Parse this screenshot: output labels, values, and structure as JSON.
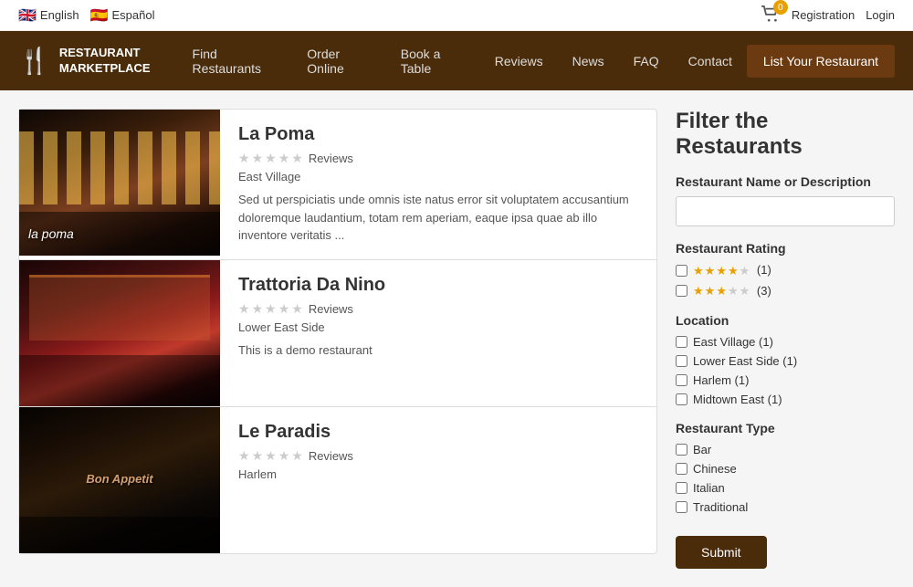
{
  "topBar": {
    "languages": [
      {
        "name": "English",
        "flag": "🇬🇧"
      },
      {
        "name": "Español",
        "flag": "🇪🇸"
      }
    ],
    "cartCount": "0",
    "links": [
      "Registration",
      "Login"
    ]
  },
  "nav": {
    "brand": {
      "icon": "🍴",
      "line1": "RESTAURANT",
      "line2": "MARKETPLACE"
    },
    "links": [
      "Find Restaurants",
      "Order Online",
      "Book a Table",
      "Reviews",
      "News",
      "FAQ",
      "Contact"
    ],
    "cta": "List Your Restaurant"
  },
  "filter": {
    "title": "Filter the Restaurants",
    "namePlaceholder": "",
    "nameLabel": "Restaurant Name or Description",
    "ratingLabel": "Restaurant Rating",
    "ratings": [
      {
        "stars": 4,
        "count": "(1)"
      },
      {
        "stars": 3,
        "count": "(3)"
      }
    ],
    "locationLabel": "Location",
    "locations": [
      "East Village (1)",
      "Lower East Side (1)",
      "Harlem (1)",
      "Midtown East (1)"
    ],
    "typeLabel": "Restaurant Type",
    "types": [
      "Bar",
      "Chinese",
      "Italian",
      "Traditional"
    ],
    "submitLabel": "Submit"
  },
  "restaurants": [
    {
      "name": "La Poma",
      "stars": 0,
      "reviewsLabel": "Reviews",
      "location": "East Village",
      "desc": "Sed ut perspiciatis unde omnis iste natus error sit voluptatem accusantium doloremque laudantium, totam rem aperiam, eaque ipsa quae ab illo inventore veritatis ...",
      "imgLabel": "la poma"
    },
    {
      "name": "Trattoria Da Nino",
      "stars": 0,
      "reviewsLabel": "Reviews",
      "location": "Lower East Side",
      "desc": "This is a demo restaurant",
      "imgLabel": ""
    },
    {
      "name": "Le Paradis",
      "stars": 0,
      "reviewsLabel": "Reviews",
      "location": "Harlem",
      "desc": "",
      "imgLabel": "Bon Appetit"
    }
  ]
}
